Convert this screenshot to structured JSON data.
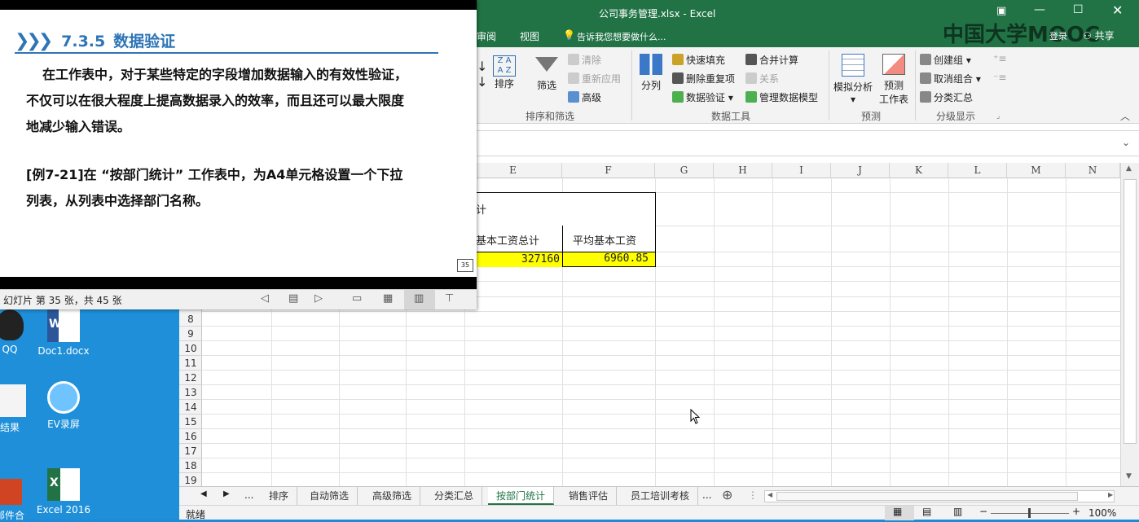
{
  "excel": {
    "window_title": "公司事务管理.xlsx - Excel",
    "share_label": "共享",
    "login_label": "登录",
    "watermark": "中国大学MOOC",
    "tabs": [
      "审阅",
      "视图"
    ],
    "tell_me": "告诉我您想要做什么...",
    "ribbon": {
      "sort_label": "排序",
      "filter_label": "筛选",
      "clear_label": "清除",
      "reapply_label": "重新应用",
      "advanced_label": "高级",
      "group_sort_filter": "排序和筛选",
      "split_label": "分列",
      "flash_fill_label": "快速填充",
      "remove_dup_label": "删除重复项",
      "data_validation_label": "数据验证",
      "consolidate_label": "合并计算",
      "relationships_label": "关系",
      "data_model_label": "管理数据模型",
      "group_data_tools": "数据工具",
      "whatif_label": "模拟分析",
      "forecast_label1": "预测",
      "forecast_label2": "工作表",
      "group_forecast": "预测",
      "create_group_label": "创建组",
      "ungroup_label": "取消组合",
      "subtotal_label": "分类汇总",
      "group_outline": "分级显示"
    },
    "columns": [
      "E",
      "F",
      "G",
      "H",
      "I",
      "J",
      "K",
      "L",
      "M",
      "N"
    ],
    "rows": [
      "8",
      "9",
      "10",
      "11",
      "12",
      "13",
      "14",
      "15",
      "16",
      "17",
      "18",
      "19"
    ],
    "cells": {
      "header_e": "基本工资总计",
      "header_f": "平均基本工资",
      "value_e": "327160",
      "value_f": "6960.85",
      "title_fragment": "计"
    },
    "sheet_tabs": [
      "排序",
      "自动筛选",
      "高级筛选",
      "分类汇总",
      "按部门统计",
      "销售评估",
      "员工培训考核"
    ],
    "more_tabs": "...",
    "status_ready": "就绪",
    "zoom": "100%",
    "highlight_color": "#ffff00",
    "accent_color": "#217346"
  },
  "slide": {
    "title_number": "7.3.5",
    "title_text": "数据验证",
    "para1_line1": "在工作表中，对于某些特定的字段增加数据输入的有效性验证，",
    "para1_line2": "不仅可以在很大程度上提高数据录入的效率，而且还可以最大限度",
    "para1_line3": "地减少输入错误。",
    "para2_line1": "[例7-21]在 “按部门统计” 工作表中，为A4单元格设置一个下拉",
    "para2_line2": "列表，从列表中选择部门名称。",
    "page_badge": "35",
    "status_text": "幻灯片 第 35 张，共 45 张",
    "title_color": "#2e75b6"
  },
  "desktop": {
    "icons": [
      "QQ",
      "Doc1.docx",
      "结果",
      "EV录屏",
      "邮件合",
      "Excel 2016"
    ]
  }
}
